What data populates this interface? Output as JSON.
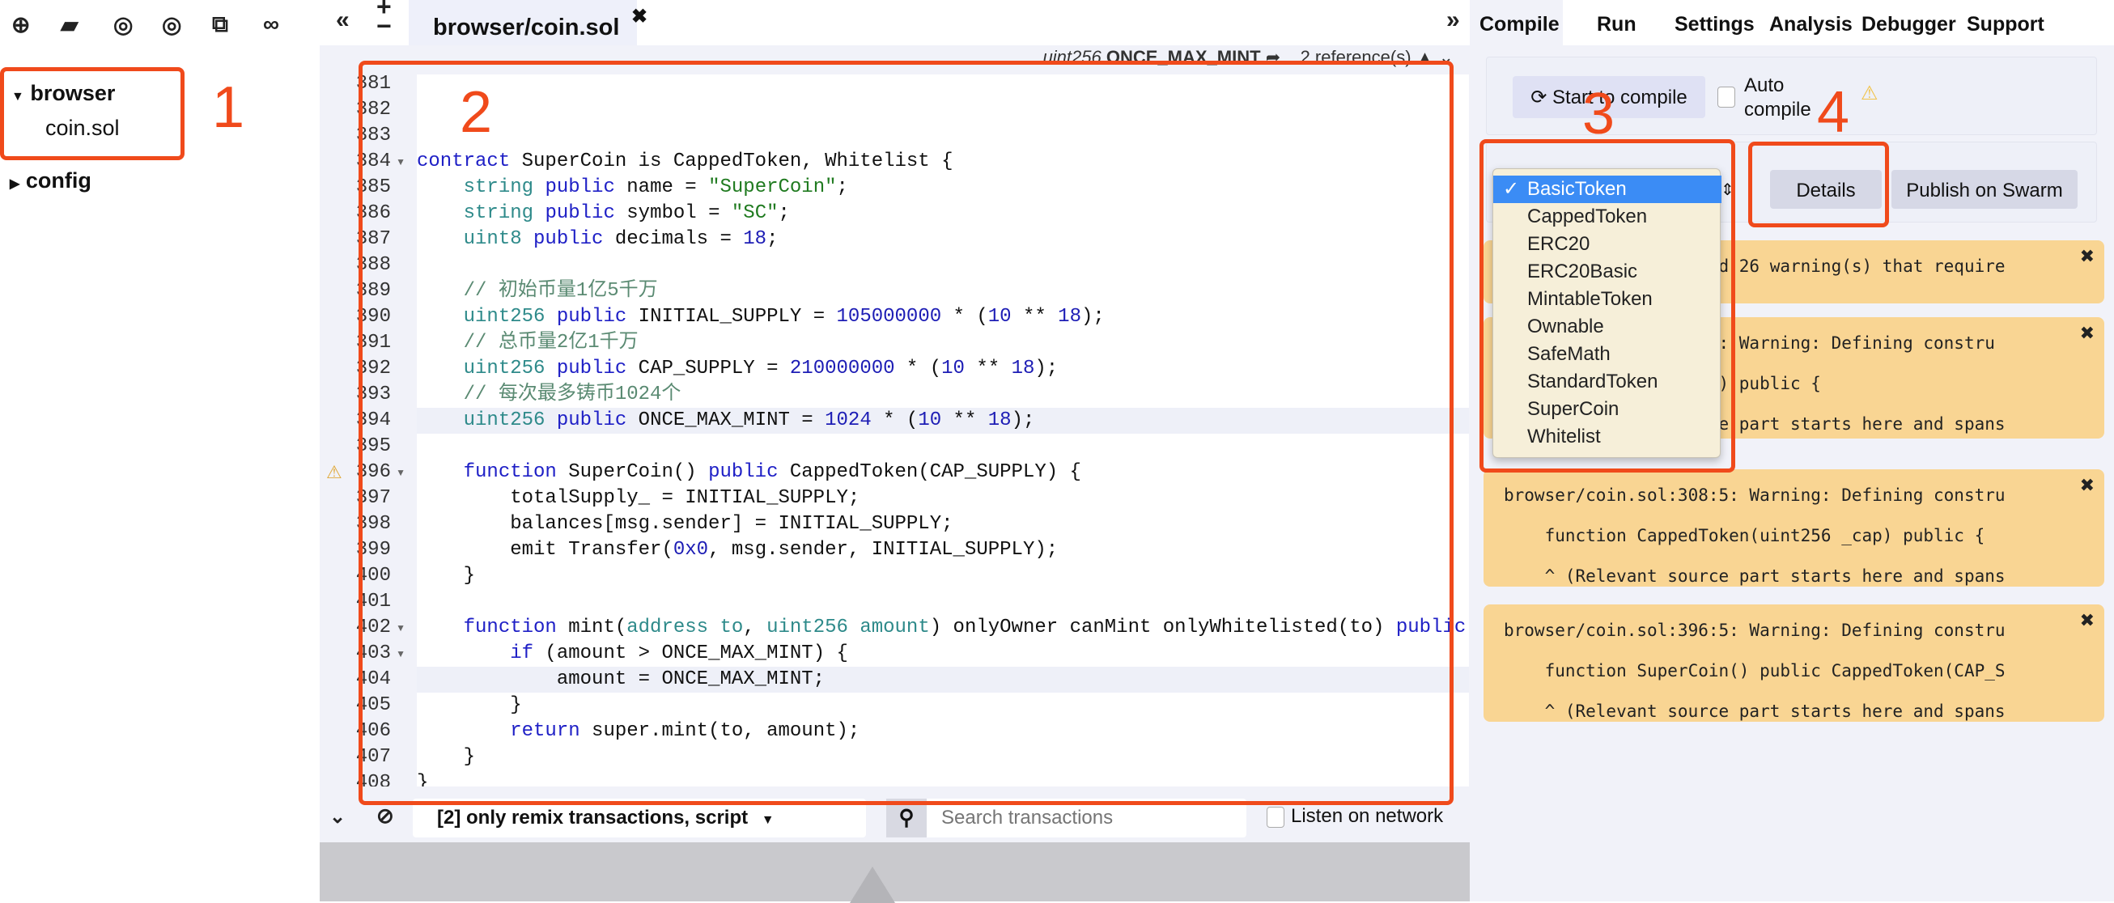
{
  "file_panel": {
    "toolbar_icons": [
      "plus-circle-icon",
      "folder-open-icon",
      "github-icon",
      "github-icon",
      "copy-icon",
      "link-icon"
    ],
    "tree": [
      {
        "label": "browser",
        "expanded": true,
        "children": [
          "coin.sol"
        ]
      },
      {
        "label": "config",
        "expanded": false,
        "children": []
      }
    ]
  },
  "editor": {
    "tab_label": "browser/coin.sol",
    "ref_type": "uint256",
    "ref_name": "ONCE_MAX_MINT",
    "ref_count": "2 reference(s)",
    "warning_line": 396,
    "fold_lines": [
      384,
      396,
      402,
      403
    ],
    "highlight_lines": [
      394,
      404
    ],
    "lines": [
      {
        "no": "381",
        "tokens": []
      },
      {
        "no": "382",
        "tokens": []
      },
      {
        "no": "383",
        "tokens": []
      },
      {
        "no": "384",
        "tokens": [
          [
            "k",
            "contract"
          ],
          [
            "p",
            " SuperCoin is CappedToken, Whitelist {"
          ]
        ]
      },
      {
        "no": "385",
        "tokens": [
          [
            "p",
            "    "
          ],
          [
            "t",
            "string"
          ],
          [
            "p",
            " "
          ],
          [
            "k",
            "public"
          ],
          [
            "p",
            " name = "
          ],
          [
            "s",
            "\"SuperCoin\""
          ],
          [
            "p",
            ";"
          ]
        ]
      },
      {
        "no": "386",
        "tokens": [
          [
            "p",
            "    "
          ],
          [
            "t",
            "string"
          ],
          [
            "p",
            " "
          ],
          [
            "k",
            "public"
          ],
          [
            "p",
            " symbol = "
          ],
          [
            "s",
            "\"SC\""
          ],
          [
            "p",
            ";"
          ]
        ]
      },
      {
        "no": "387",
        "tokens": [
          [
            "p",
            "    "
          ],
          [
            "t",
            "uint8"
          ],
          [
            "p",
            " "
          ],
          [
            "k",
            "public"
          ],
          [
            "p",
            " decimals = "
          ],
          [
            "n",
            "18"
          ],
          [
            "p",
            ";"
          ]
        ]
      },
      {
        "no": "388",
        "tokens": []
      },
      {
        "no": "389",
        "tokens": [
          [
            "p",
            "    "
          ],
          [
            "c",
            "// 初始币量1亿5千万"
          ]
        ]
      },
      {
        "no": "390",
        "tokens": [
          [
            "p",
            "    "
          ],
          [
            "t",
            "uint256"
          ],
          [
            "p",
            " "
          ],
          [
            "k",
            "public"
          ],
          [
            "p",
            " INITIAL_SUPPLY = "
          ],
          [
            "n",
            "105000000"
          ],
          [
            "p",
            " * ("
          ],
          [
            "n",
            "10"
          ],
          [
            "p",
            " ** "
          ],
          [
            "n",
            "18"
          ],
          [
            "p",
            ");"
          ]
        ]
      },
      {
        "no": "391",
        "tokens": [
          [
            "p",
            "    "
          ],
          [
            "c",
            "// 总币量2亿1千万"
          ]
        ]
      },
      {
        "no": "392",
        "tokens": [
          [
            "p",
            "    "
          ],
          [
            "t",
            "uint256"
          ],
          [
            "p",
            " "
          ],
          [
            "k",
            "public"
          ],
          [
            "p",
            " CAP_SUPPLY = "
          ],
          [
            "n",
            "210000000"
          ],
          [
            "p",
            " * ("
          ],
          [
            "n",
            "10"
          ],
          [
            "p",
            " ** "
          ],
          [
            "n",
            "18"
          ],
          [
            "p",
            ");"
          ]
        ]
      },
      {
        "no": "393",
        "tokens": [
          [
            "p",
            "    "
          ],
          [
            "c",
            "// 每次最多铸币1024个"
          ]
        ]
      },
      {
        "no": "394",
        "tokens": [
          [
            "p",
            "    "
          ],
          [
            "t",
            "uint256"
          ],
          [
            "p",
            " "
          ],
          [
            "k",
            "public"
          ],
          [
            "p",
            " ONCE_MAX_MINT = "
          ],
          [
            "n",
            "1024"
          ],
          [
            "p",
            " * ("
          ],
          [
            "n",
            "10"
          ],
          [
            "p",
            " ** "
          ],
          [
            "n",
            "18"
          ],
          [
            "p",
            ");"
          ]
        ]
      },
      {
        "no": "395",
        "tokens": []
      },
      {
        "no": "396",
        "tokens": [
          [
            "p",
            "    "
          ],
          [
            "k",
            "function"
          ],
          [
            "p",
            " SuperCoin() "
          ],
          [
            "k",
            "public"
          ],
          [
            "p",
            " CappedToken(CAP_SUPPLY) {"
          ]
        ]
      },
      {
        "no": "397",
        "tokens": [
          [
            "p",
            "        totalSupply_ = INITIAL_SUPPLY;"
          ]
        ]
      },
      {
        "no": "398",
        "tokens": [
          [
            "p",
            "        balances[msg.sender] = INITIAL_SUPPLY;"
          ]
        ]
      },
      {
        "no": "399",
        "tokens": [
          [
            "p",
            "        emit Transfer("
          ],
          [
            "n",
            "0x0"
          ],
          [
            "p",
            ", msg.sender, INITIAL_SUPPLY);"
          ]
        ]
      },
      {
        "no": "400",
        "tokens": [
          [
            "p",
            "    }"
          ]
        ]
      },
      {
        "no": "401",
        "tokens": []
      },
      {
        "no": "402",
        "tokens": [
          [
            "p",
            "    "
          ],
          [
            "k",
            "function"
          ],
          [
            "p",
            " mint("
          ],
          [
            "t",
            "address to"
          ],
          [
            "p",
            ", "
          ],
          [
            "t",
            "uint256 amount"
          ],
          [
            "p",
            ") onlyOwner canMint onlyWhitelisted(to) "
          ],
          [
            "k",
            "public"
          ]
        ]
      },
      {
        "no": "403",
        "tokens": [
          [
            "p",
            "        "
          ],
          [
            "k",
            "if"
          ],
          [
            "p",
            " (amount > ONCE_MAX_MINT) {"
          ]
        ]
      },
      {
        "no": "404",
        "tokens": [
          [
            "p",
            "            amount = ONCE_MAX_MINT;"
          ]
        ]
      },
      {
        "no": "405",
        "tokens": [
          [
            "p",
            "        }"
          ]
        ]
      },
      {
        "no": "406",
        "tokens": [
          [
            "p",
            "        "
          ],
          [
            "k",
            "return"
          ],
          [
            "p",
            " super.mint(to, amount);"
          ]
        ]
      },
      {
        "no": "407",
        "tokens": [
          [
            "p",
            "    }"
          ]
        ]
      },
      {
        "no": "408",
        "tokens": [
          [
            "p",
            "}"
          ]
        ]
      }
    ]
  },
  "terminal": {
    "filter_label": "[2] only remix transactions, script",
    "search_placeholder": "Search transactions",
    "listen_label": "Listen on network"
  },
  "right_panel": {
    "tabs": [
      "Compile",
      "Run",
      "Settings",
      "Analysis",
      "Debugger",
      "Support"
    ],
    "active_tab": "Compile",
    "compile_button": "Start to compile",
    "auto_compile_label": "Auto compile",
    "contract_options": [
      "BasicToken",
      "CappedToken",
      "ERC20",
      "ERC20Basic",
      "MintableToken",
      "Ownable",
      "SafeMath",
      "StandardToken",
      "SuperCoin",
      "Whitelist"
    ],
    "selected_contract": "BasicToken",
    "details_button": "Details",
    "publish_button": "Publish on Swarm",
    "warnings": [
      {
        "lines": [
          "Static Analysis raised 26 warning(s) that require"
        ]
      },
      {
        "lines": [
          "browser/coin.sol:35:5: Warning: Defining constru",
          "    function Ownable() public {",
          "    ^ (Relevant source part starts here and spans"
        ]
      },
      {
        "lines": [
          "browser/coin.sol:308:5: Warning: Defining constru",
          "    function CappedToken(uint256 _cap) public {",
          "    ^ (Relevant source part starts here and spans"
        ]
      },
      {
        "lines": [
          "browser/coin.sol:396:5: Warning: Defining constru",
          "    function SuperCoin() public CappedToken(CAP_S",
          "    ^ (Relevant source part starts here and spans"
        ]
      }
    ]
  },
  "annotations": [
    "1",
    "2",
    "3",
    "4"
  ],
  "colors": {
    "annotation": "#f04a1b",
    "warning_bg": "#f9d593",
    "selected_option": "#3b8cf5"
  }
}
